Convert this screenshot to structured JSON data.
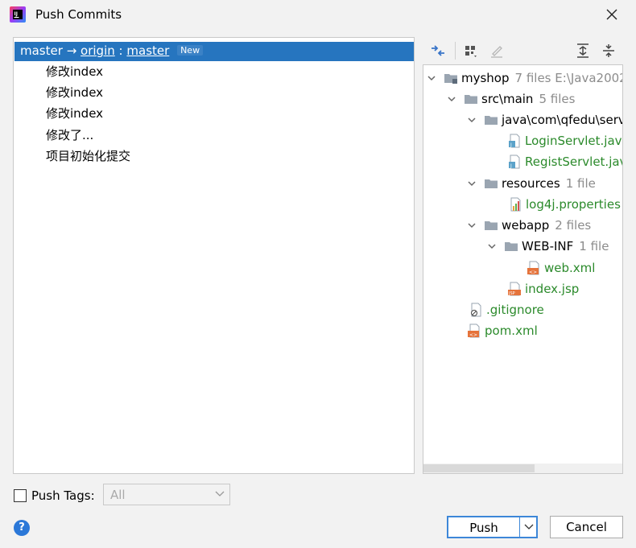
{
  "window": {
    "title": "Push Commits"
  },
  "branch": {
    "local": "master",
    "arrow": "→",
    "remote": "origin",
    "separator": ":",
    "remote_branch": "master",
    "badge": "New"
  },
  "commits": [
    "修改index",
    "修改index",
    "修改index",
    "修改了...",
    "项目初始化提交"
  ],
  "file_tree": {
    "root": {
      "name": "myshop",
      "meta": "7 files  E:\\Java2002"
    },
    "src_main": {
      "name": "src\\main",
      "meta": "5 files"
    },
    "java_pkg": {
      "name": "java\\com\\qfedu\\serv"
    },
    "login_servlet": {
      "name": "LoginServlet.java"
    },
    "regist_servlet": {
      "name": "RegistServlet.java"
    },
    "resources": {
      "name": "resources",
      "meta": "1 file"
    },
    "log4j": {
      "name": "log4j.properties"
    },
    "webapp": {
      "name": "webapp",
      "meta": "2 files"
    },
    "webinf": {
      "name": "WEB-INF",
      "meta": "1 file"
    },
    "webxml": {
      "name": "web.xml"
    },
    "indexjsp": {
      "name": "index.jsp"
    },
    "gitignore": {
      "name": ".gitignore"
    },
    "pomxml": {
      "name": "pom.xml"
    }
  },
  "footer": {
    "push_tags_label": "Push Tags:",
    "tags_select_value": "All",
    "push_label": "Push",
    "cancel_label": "Cancel",
    "help_label": "?"
  },
  "colors": {
    "selection": "#2675bf",
    "added_file": "#2b8a2b",
    "meta_text": "#8c8c8c",
    "accent_border": "#3d87d8"
  }
}
